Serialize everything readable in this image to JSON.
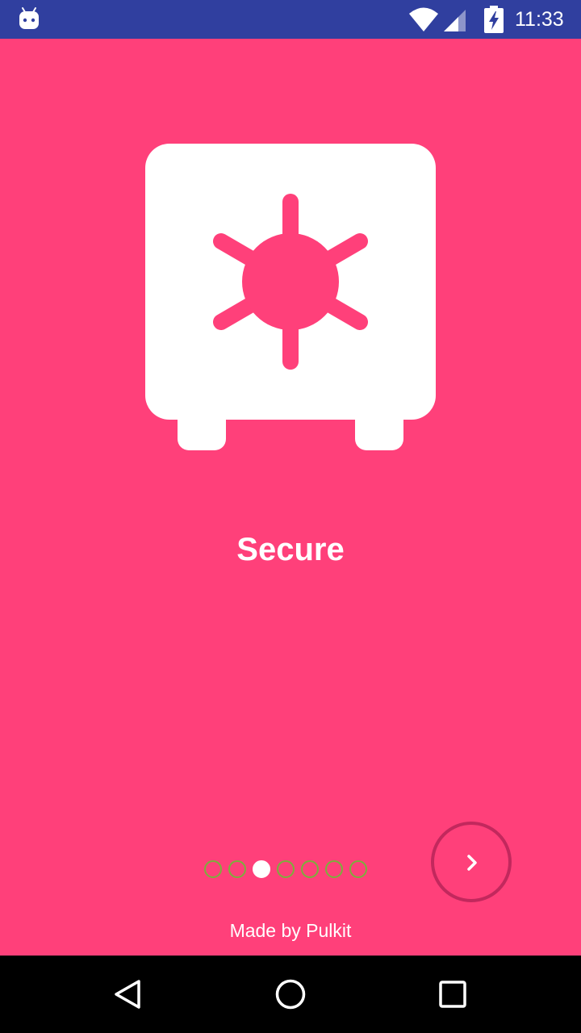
{
  "status_bar": {
    "time": "11:33",
    "icons": [
      "android-icon",
      "wifi-icon",
      "signal-icon",
      "battery-charging-icon"
    ],
    "background": "#303f9f"
  },
  "onboarding": {
    "background": "#ff407a",
    "icon": "safe-icon",
    "title": "Secure",
    "page_count": 7,
    "current_page": 3,
    "next_icon": "chevron-right-icon",
    "footer": "Made by Pulkit",
    "indicator_color": "#7caf3c",
    "button_ring_color": "#c2285d"
  },
  "nav_bar": {
    "buttons": [
      "back-icon",
      "home-icon",
      "recents-icon"
    ]
  }
}
